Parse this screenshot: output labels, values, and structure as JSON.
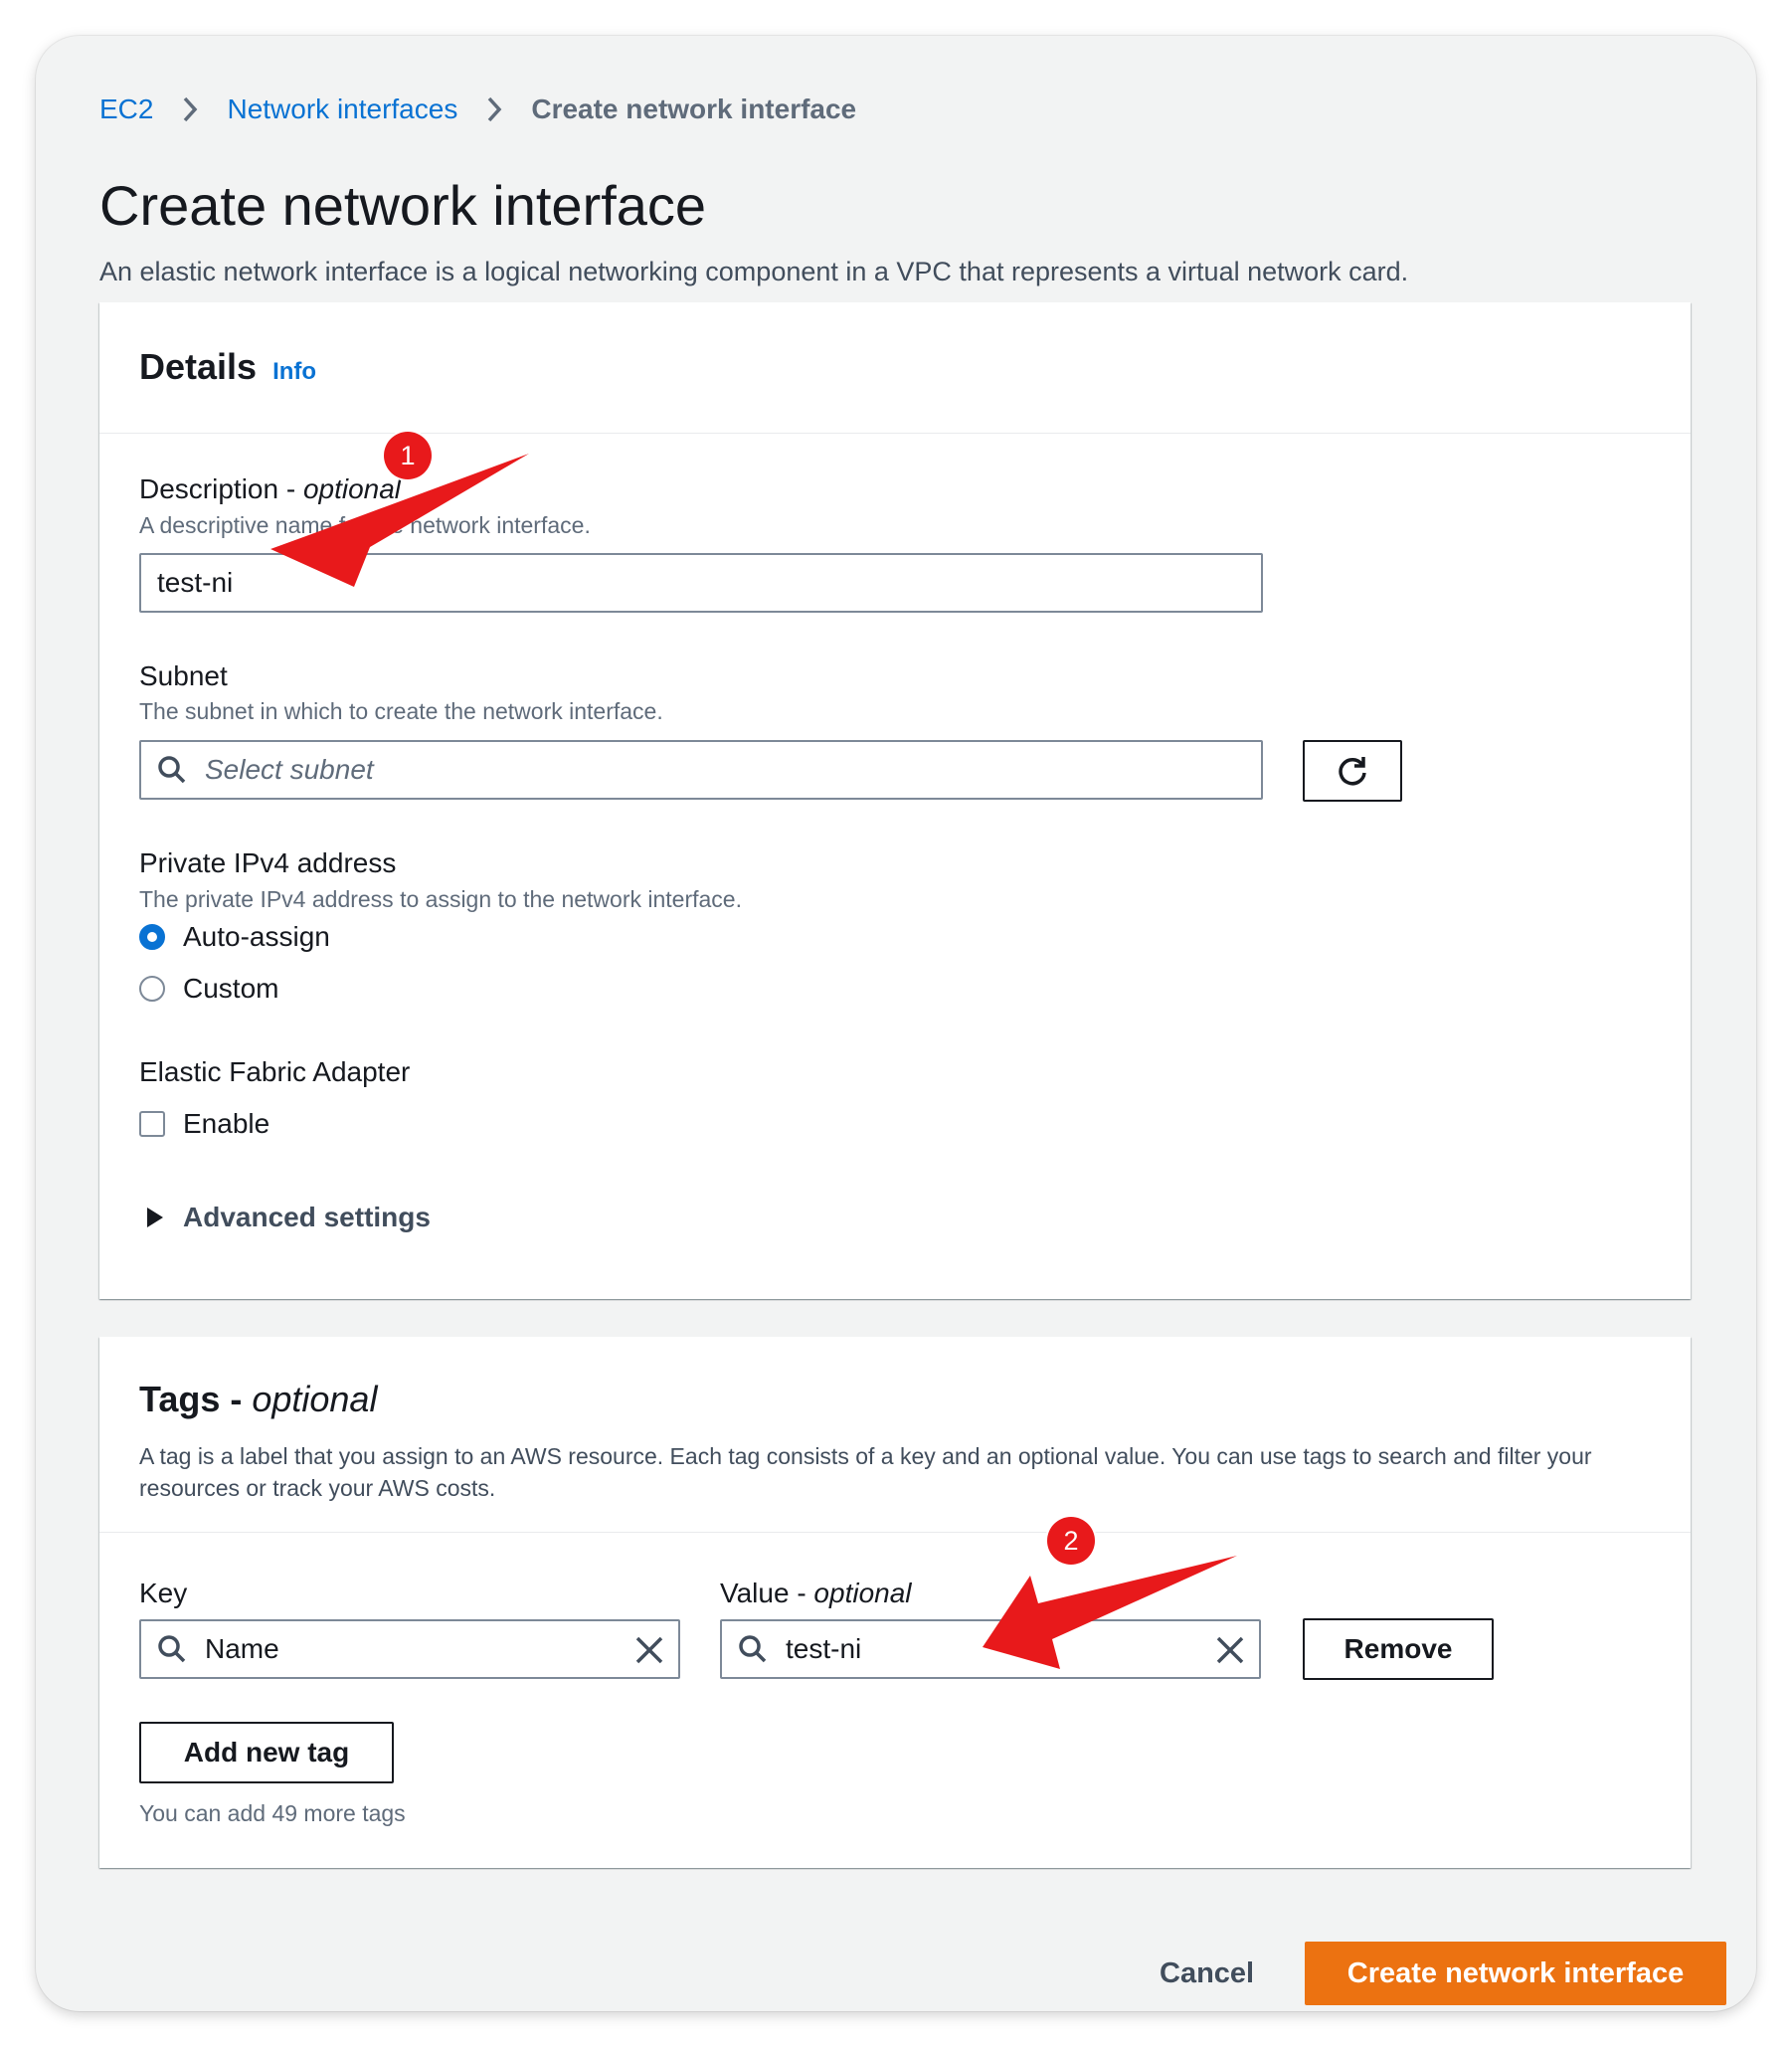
{
  "breadcrumb": {
    "items": [
      "EC2",
      "Network interfaces"
    ],
    "current": "Create network interface"
  },
  "page": {
    "title": "Create network interface",
    "description": "An elastic network interface is a logical networking component in a VPC that represents a virtual network card."
  },
  "details": {
    "title": "Details",
    "info_link": "Info",
    "description_field": {
      "label": "Description - ",
      "label_optional": "optional",
      "help": "A descriptive name for the network interface.",
      "value": "test-ni"
    },
    "subnet_field": {
      "label": "Subnet",
      "help": "The subnet in which to create the network interface.",
      "placeholder": "Select subnet"
    },
    "ipv4_field": {
      "label": "Private IPv4 address",
      "help": "The private IPv4 address to assign to the network interface.",
      "options": [
        "Auto-assign",
        "Custom"
      ],
      "selected": "Auto-assign"
    },
    "efa_field": {
      "label": "Elastic Fabric Adapter",
      "checkbox_label": "Enable",
      "checked": false
    },
    "advanced": "Advanced settings"
  },
  "tags": {
    "title": "Tags - ",
    "title_optional": "optional",
    "description": "A tag is a label that you assign to an AWS resource. Each tag consists of a key and an optional value. You can use tags to search and filter your resources or track your AWS costs.",
    "key_label": "Key",
    "value_label": "Value - ",
    "value_label_optional": "optional",
    "rows": [
      {
        "key": "Name",
        "value": "test-ni"
      }
    ],
    "remove_label": "Remove",
    "add_label": "Add new tag",
    "remaining": "You can add 49 more tags"
  },
  "footer": {
    "cancel": "Cancel",
    "submit": "Create network interface"
  },
  "annotations": {
    "badges": [
      "1",
      "2"
    ],
    "color": "#e8191b"
  },
  "colors": {
    "link": "#0972d3",
    "primary": "#ec7211",
    "background": "#f2f3f3"
  }
}
